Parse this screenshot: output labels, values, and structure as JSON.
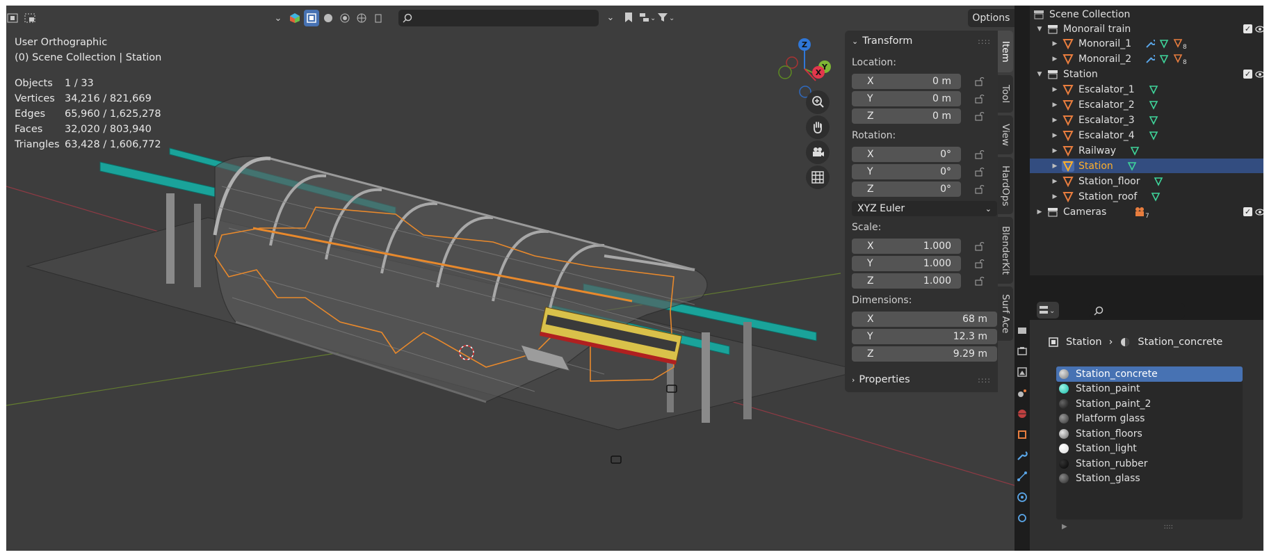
{
  "viewport": {
    "view_name": "User Orthographic",
    "collection_path": "(0) Scene Collection | Station",
    "stats": [
      {
        "label": "Objects",
        "value": "1 / 33"
      },
      {
        "label": "Vertices",
        "value": "34,216 / 821,669"
      },
      {
        "label": "Edges",
        "value": "65,960 / 1,625,278"
      },
      {
        "label": "Faces",
        "value": "32,020 / 803,940"
      },
      {
        "label": "Triangles",
        "value": "63,428 / 1,606,772"
      }
    ],
    "options_label": "Options",
    "gizmo_axes": {
      "x": "X",
      "y": "Y",
      "z": "Z"
    }
  },
  "npanel": {
    "transform_title": "Transform",
    "location_label": "Location:",
    "location": [
      {
        "axis": "X",
        "value": "0 m"
      },
      {
        "axis": "Y",
        "value": "0 m"
      },
      {
        "axis": "Z",
        "value": "0 m"
      }
    ],
    "rotation_label": "Rotation:",
    "rotation": [
      {
        "axis": "X",
        "value": "0°"
      },
      {
        "axis": "Y",
        "value": "0°"
      },
      {
        "axis": "Z",
        "value": "0°"
      }
    ],
    "rotation_mode": "XYZ Euler",
    "scale_label": "Scale:",
    "scale": [
      {
        "axis": "X",
        "value": "1.000"
      },
      {
        "axis": "Y",
        "value": "1.000"
      },
      {
        "axis": "Z",
        "value": "1.000"
      }
    ],
    "dimensions_label": "Dimensions:",
    "dimensions": [
      {
        "axis": "X",
        "value": "68 m"
      },
      {
        "axis": "Y",
        "value": "12.3 m"
      },
      {
        "axis": "Z",
        "value": "9.29 m"
      }
    ],
    "properties_title": "Properties",
    "tabs": [
      "Item",
      "Tool",
      "View",
      "HardOps",
      "BlenderKit",
      "Surf Ace"
    ]
  },
  "outliner": {
    "root": "Scene Collection",
    "monorail_collection": "Monorail train",
    "monorail_1": "Monorail_1",
    "monorail_2": "Monorail_2",
    "monorail_badge": "8",
    "station_collection": "Station",
    "escalator_1": "Escalator_1",
    "escalator_2": "Escalator_2",
    "escalator_3": "Escalator_3",
    "escalator_4": "Escalator_4",
    "railway": "Railway",
    "station": "Station",
    "station_floor": "Station_floor",
    "station_roof": "Station_roof",
    "cameras_collection": "Cameras",
    "cameras_badge": "7",
    "check": "✓"
  },
  "properties": {
    "object_name": "Station",
    "material_name": "Station_concrete",
    "materials": [
      {
        "name": "Station_concrete",
        "color": "#9a9a9a"
      },
      {
        "name": "Station_paint",
        "color": "#2ee0c8"
      },
      {
        "name": "Station_paint_2",
        "color": "#222222"
      },
      {
        "name": "Platform glass",
        "color": "#6a6a6a"
      },
      {
        "name": "Station_floors",
        "color": "#8c8c8c"
      },
      {
        "name": "Station_light",
        "color": "#ffffff"
      },
      {
        "name": "Station_rubber",
        "color": "#111111"
      },
      {
        "name": "Station_glass",
        "color": "#555555"
      }
    ]
  },
  "colors": {
    "accent": "#4772b3",
    "selection": "#ffaf29",
    "teal": "#1aa39a",
    "mesh_icon": "#e87d3e",
    "vertex_icon": "#3fd49a"
  }
}
